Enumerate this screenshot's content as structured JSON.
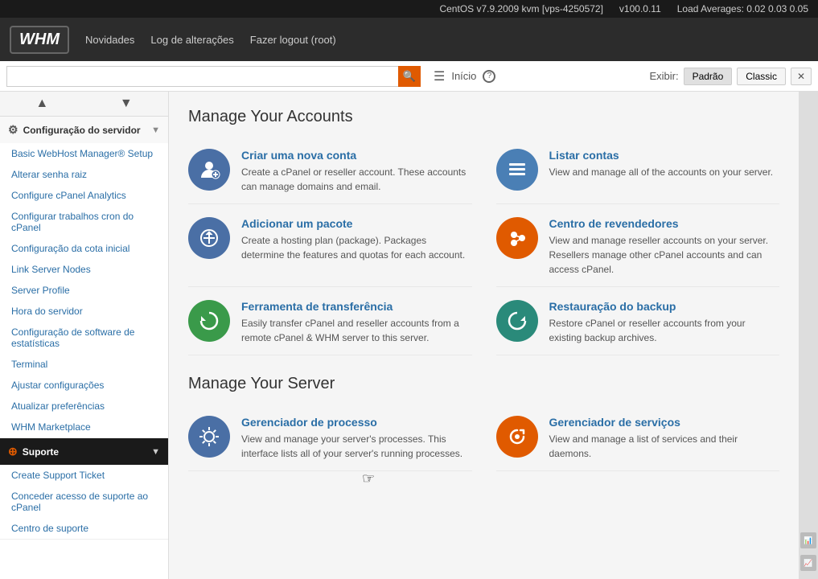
{
  "topbar": {
    "server_info": "CentOS v7.9.2009 kvm [vps-4250572]",
    "version": "v100.0.11",
    "load_averages": "Load Averages: 0.02 0.03 0.05"
  },
  "header": {
    "logo": "WHM",
    "nav": [
      {
        "label": "Novidades",
        "id": "novidades"
      },
      {
        "label": "Log de alterações",
        "id": "log-alteracoes"
      },
      {
        "label": "Fazer logout (root)",
        "id": "logout"
      }
    ]
  },
  "search": {
    "placeholder": "",
    "breadcrumb": "Início"
  },
  "display": {
    "label": "Exibir:",
    "options": [
      "Padrão",
      "Classic"
    ]
  },
  "sidebar": {
    "sections": [
      {
        "id": "config-servidor",
        "icon": "⚙",
        "label": "Configuração do servidor",
        "items": [
          "Basic WebHost Manager® Setup",
          "Alterar senha raiz",
          "Configure cPanel Analytics",
          "Configurar trabalhos cron do cPanel",
          "Configuração da cota inicial",
          "Link Server Nodes",
          "Server Profile",
          "Hora do servidor",
          "Configuração de software de estatísticas",
          "Terminal",
          "Ajustar configurações",
          "Atualizar preferências",
          "WHM Marketplace"
        ]
      },
      {
        "id": "suporte",
        "icon": "⊕",
        "label": "Suporte",
        "items": [
          "Create Support Ticket",
          "Conceder acesso de suporte ao cPanel",
          "Centro de suporte"
        ]
      }
    ]
  },
  "content": {
    "manage_accounts_title": "Manage Your Accounts",
    "manage_server_title": "Manage Your Server",
    "account_cards": [
      {
        "id": "criar-conta",
        "icon": "👤",
        "icon_class": "icon-blue",
        "title": "Criar uma nova conta",
        "desc": "Create a cPanel or reseller account. These accounts can manage domains and email."
      },
      {
        "id": "listar-contas",
        "icon": "☰",
        "icon_class": "icon-blue-outline",
        "title": "Listar contas",
        "desc": "View and manage all of the accounts on your server."
      },
      {
        "id": "adicionar-pacote",
        "icon": "📦",
        "icon_class": "icon-blue",
        "title": "Adicionar um pacote",
        "desc": "Create a hosting plan (package). Packages determine the features and quotas for each account."
      },
      {
        "id": "centro-revendedores",
        "icon": "↗",
        "icon_class": "icon-orange",
        "title": "Centro de revendedores",
        "desc": "View and manage reseller accounts on your server. Resellers manage other cPanel accounts and can access cPanel."
      },
      {
        "id": "ferramenta-transferencia",
        "icon": "⟳",
        "icon_class": "icon-green",
        "title": "Ferramenta de transferência",
        "desc": "Easily transfer cPanel and reseller accounts from a remote cPanel & WHM server to this server."
      },
      {
        "id": "restauracao-backup",
        "icon": "⟳",
        "icon_class": "icon-teal",
        "title": "Restauração do backup",
        "desc": "Restore cPanel or reseller accounts from your existing backup archives."
      }
    ],
    "server_cards": [
      {
        "id": "gerenciador-processo",
        "icon": "⚙",
        "icon_class": "icon-blue",
        "title": "Gerenciador de processo",
        "desc": "View and manage your server's processes. This interface lists all of your server's running processes."
      },
      {
        "id": "gerenciador-servicos",
        "icon": "🔧",
        "icon_class": "icon-orange",
        "title": "Gerenciador de serviços",
        "desc": "View and manage a list of services and their daemons."
      }
    ]
  }
}
